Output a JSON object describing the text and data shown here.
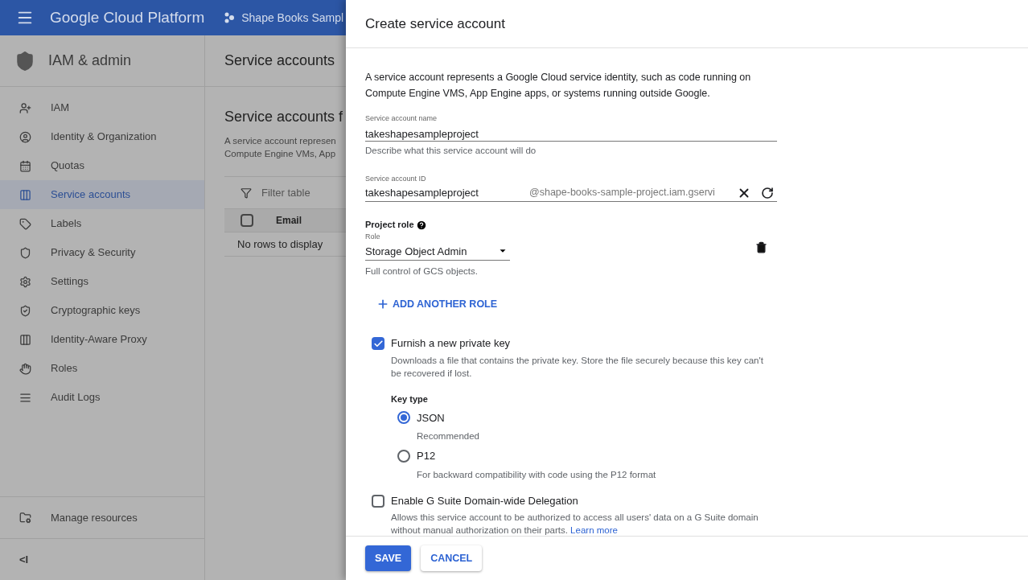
{
  "header": {
    "product": "Google Cloud Platform",
    "project": "Shape Books Sampl"
  },
  "sidebar": {
    "title": "IAM & admin",
    "items": [
      {
        "label": "IAM",
        "selected": false
      },
      {
        "label": "Identity & Organization",
        "selected": false
      },
      {
        "label": "Quotas",
        "selected": false
      },
      {
        "label": "Service accounts",
        "selected": true
      },
      {
        "label": "Labels",
        "selected": false
      },
      {
        "label": "Privacy & Security",
        "selected": false
      },
      {
        "label": "Settings",
        "selected": false
      },
      {
        "label": "Cryptographic keys",
        "selected": false
      },
      {
        "label": "Identity-Aware Proxy",
        "selected": false
      },
      {
        "label": "Roles",
        "selected": false
      },
      {
        "label": "Audit Logs",
        "selected": false
      }
    ],
    "footer_item": "Manage resources",
    "collapse": "<I"
  },
  "page": {
    "title": "Service accounts",
    "section_title": "Service accounts f",
    "description": [
      "A service account represen",
      "Compute Engine VMs, App"
    ],
    "filter_placeholder": "Filter table",
    "columns": [
      "Email"
    ],
    "select_all_checked": false,
    "empty": "No rows to display"
  },
  "dialog": {
    "title": "Create service account",
    "intro": "A service account represents a Google Cloud service identity, such as code running on Compute Engine VMS, App Engine apps, or systems running outside Google.",
    "name_field": {
      "label": "Service account name",
      "value": "takeshapesampleproject",
      "hint": "Describe what this service account will do"
    },
    "id_field": {
      "label": "Service account ID",
      "value": "takeshapesampleproject",
      "suffix": "@shape-books-sample-project.iam.gservi"
    },
    "project_role": {
      "heading": "Project role",
      "role_label": "Role",
      "role_value": "Storage Object Admin",
      "role_hint": "Full control of GCS objects.",
      "add": "ADD ANOTHER ROLE"
    },
    "options": [
      {
        "label": "Furnish a new private key",
        "checked": true,
        "description": "Downloads a file that contains the private key. Store the file securely because this key can't be recovered if lost.",
        "key_type": {
          "heading": "Key type",
          "choices": [
            {
              "label": "JSON",
              "hint": "Recommended",
              "selected": true
            },
            {
              "label": "P12",
              "hint": "For backward compatibility with code using the P12 format",
              "selected": false
            }
          ]
        }
      },
      {
        "label": "Enable G Suite Domain-wide Delegation",
        "checked": false,
        "description": "Allows this service account to be authorized to access all users' data on a G Suite domain without manual authorization on their parts.",
        "link": "Learn more"
      }
    ],
    "buttons": [
      {
        "label": "SAVE",
        "kind": "primary"
      },
      {
        "label": "CANCEL",
        "kind": "secondary"
      }
    ]
  }
}
